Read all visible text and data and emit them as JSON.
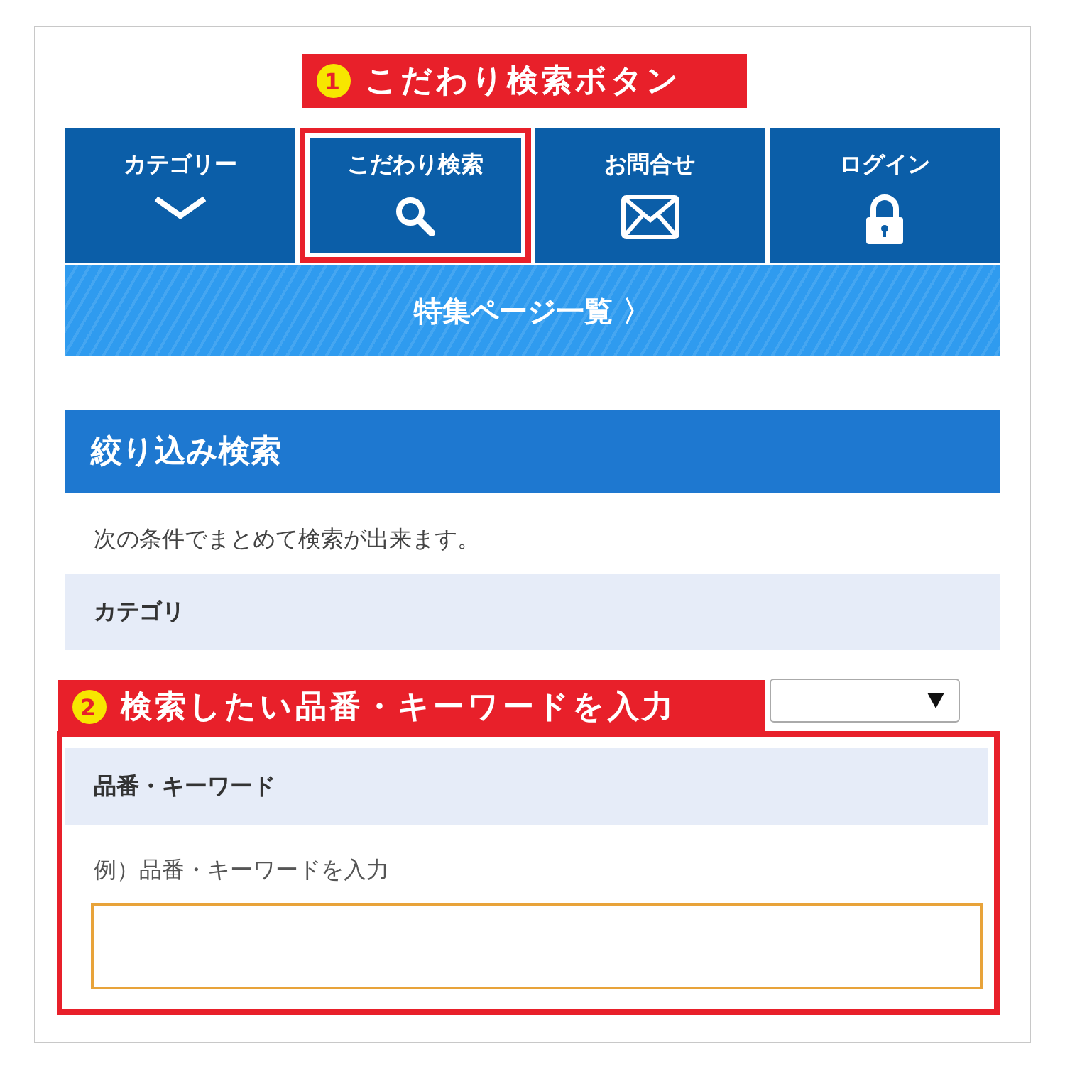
{
  "callouts": [
    {
      "number": "1",
      "text": "こだわり検索ボタン"
    },
    {
      "number": "2",
      "text": "検索したい品番・キーワードを入力"
    }
  ],
  "nav": [
    {
      "label": "カテゴリー",
      "kind": "chevron",
      "highlighted": false
    },
    {
      "label": "こだわり検索",
      "kind": "search",
      "highlighted": true
    },
    {
      "label": "お問合せ",
      "kind": "mail",
      "highlighted": false
    },
    {
      "label": "ログイン",
      "kind": "lock",
      "highlighted": false
    }
  ],
  "featured_link": "特集ページ一覧 〉",
  "panel": {
    "title": "絞り込み検索",
    "description": "次の条件でまとめて検索が出来ます。",
    "category": {
      "label": "カテゴリ"
    },
    "keyword": {
      "label": "品番・キーワード",
      "hint": "例）品番・キーワードを入力",
      "highlighted": true
    }
  }
}
